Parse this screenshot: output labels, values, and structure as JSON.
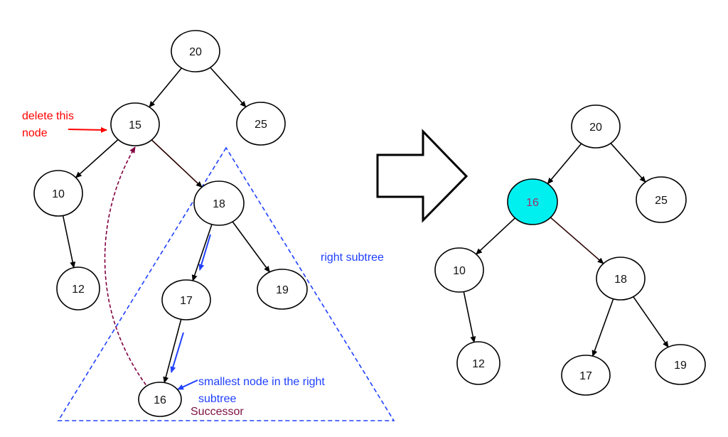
{
  "colors": {
    "edge": "#000000",
    "edge_highlight": "#2a0000",
    "delete_label": "#ff0000",
    "subtree_outline": "#2040ff",
    "successor_path": "#800040",
    "successor_label": "#7b1040",
    "replaced_fill": "#00f0f0",
    "replaced_text": "#a0306a"
  },
  "before_tree": {
    "nodes": [
      {
        "id": "b20",
        "value": "20"
      },
      {
        "id": "b15",
        "value": "15"
      },
      {
        "id": "b25",
        "value": "25"
      },
      {
        "id": "b10",
        "value": "10"
      },
      {
        "id": "b18",
        "value": "18"
      },
      {
        "id": "b12",
        "value": "12"
      },
      {
        "id": "b17",
        "value": "17"
      },
      {
        "id": "b19",
        "value": "19"
      },
      {
        "id": "b16",
        "value": "16"
      }
    ],
    "edges": [
      [
        "b20",
        "b15"
      ],
      [
        "b20",
        "b25"
      ],
      [
        "b15",
        "b10"
      ],
      [
        "b15",
        "b18"
      ],
      [
        "b10",
        "b12"
      ],
      [
        "b18",
        "b17"
      ],
      [
        "b18",
        "b19"
      ],
      [
        "b17",
        "b16"
      ]
    ]
  },
  "after_tree": {
    "nodes": [
      {
        "id": "a20",
        "value": "20"
      },
      {
        "id": "a16",
        "value": "16",
        "highlight": true
      },
      {
        "id": "a25",
        "value": "25"
      },
      {
        "id": "a10",
        "value": "10"
      },
      {
        "id": "a18",
        "value": "18"
      },
      {
        "id": "a12",
        "value": "12"
      },
      {
        "id": "a17",
        "value": "17"
      },
      {
        "id": "a19",
        "value": "19"
      }
    ],
    "edges": [
      [
        "a20",
        "a16"
      ],
      [
        "a20",
        "a25"
      ],
      [
        "a16",
        "a10"
      ],
      [
        "a16",
        "a18"
      ],
      [
        "a10",
        "a12"
      ],
      [
        "a18",
        "a17"
      ],
      [
        "a18",
        "a19"
      ]
    ]
  },
  "annotations": {
    "delete_line1": "delete this",
    "delete_line2": "node",
    "right_subtree": "right subtree",
    "smallest_line1": "smallest node in the right",
    "smallest_line2": "subtree",
    "successor": "Successor"
  }
}
